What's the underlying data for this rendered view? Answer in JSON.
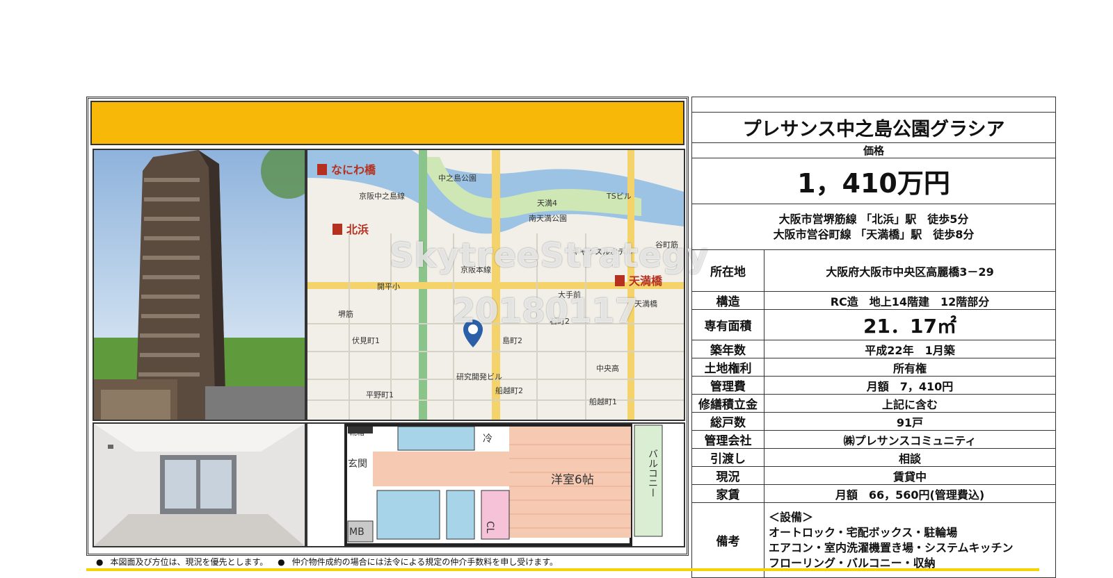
{
  "property": {
    "name": "プレサンス中之島公園グラシア",
    "price_label": "価格",
    "price": "1，410万円",
    "access": [
      "大阪市営堺筋線 「北浜」駅　徒歩5分",
      "大阪市営谷町線 「天満橋」駅　徒歩8分"
    ]
  },
  "details": [
    {
      "label": "所在地",
      "value": "大阪府大阪市中央区高麗橋3－29"
    },
    {
      "label": "構造",
      "value": "RC造　地上14階建　12階部分"
    },
    {
      "label": "専有面積",
      "value": "21．17㎡"
    },
    {
      "label": "築年数",
      "value": "平成22年　1月築"
    },
    {
      "label": "土地権利",
      "value": "所有権"
    },
    {
      "label": "管理費",
      "value": "月額　7，410円"
    },
    {
      "label": "修繕積立金",
      "value": "上記に含む"
    },
    {
      "label": "総戸数",
      "value": "91戸"
    },
    {
      "label": "管理会社",
      "value": "㈱プレサンスコミュニティ"
    },
    {
      "label": "引渡し",
      "value": "相談"
    },
    {
      "label": "現況",
      "value": "賃貸中"
    },
    {
      "label": "家賃",
      "value": "月額　66，560円(管理費込)"
    }
  ],
  "remarks": {
    "label": "備考",
    "lines": [
      "＜設備＞",
      "オートロック・宅配ボックス・駐輪場",
      "エアコン・室内洗濯機置き場・システムキッチン",
      "フローリング・バルコニー・収納"
    ]
  },
  "map": {
    "stations": [
      "なにわ橋",
      "北浜",
      "天満橋"
    ],
    "labels": [
      "京阪中之島線",
      "南天満公園",
      "中之島公園",
      "開平小",
      "伏見町1",
      "平野町1",
      "島町2",
      "石町2",
      "船越町2",
      "中央高",
      "船越町1",
      "京阪本線",
      "大手前",
      "天満橋",
      "谷町筋",
      "天満4",
      "TSビル",
      "キャッスルホテル",
      "研究開発ビル",
      "堺筋"
    ]
  },
  "floorplan": {
    "rooms": [
      "靴箱",
      "冷",
      "玄関",
      "洋室6帖",
      "バルコニー",
      "MB",
      "CL"
    ]
  },
  "watermark": {
    "text": "SkytreeStrategy",
    "date": "20180117"
  },
  "footer_notes": [
    "本図面及び方位は、現況を優先とします。",
    "仲介物件成約の場合には法令による規定の仲介手数料を申し受けます。"
  ],
  "colors": {
    "banner": "#f7b808",
    "station_red": "#b5301e"
  }
}
